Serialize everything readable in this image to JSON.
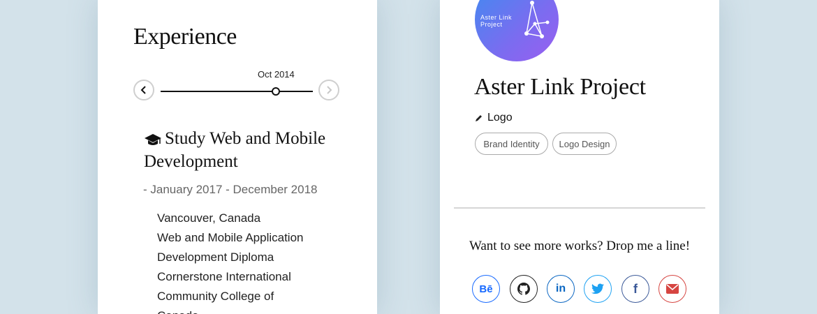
{
  "experience": {
    "title": "Experience",
    "timeline_date": "Oct 2014",
    "entry": {
      "title": "Study Web and Mobile Development",
      "period": "- January 2017 - December 2018",
      "details": [
        "Vancouver, Canada",
        "Web and Mobile Application",
        "Development Diploma",
        "Cornerstone International",
        "Community College of",
        "Canada"
      ]
    }
  },
  "project": {
    "logo_text_line1": "Aster Link",
    "logo_text_line2": "Project",
    "title": "Aster Link Project",
    "category": "Logo",
    "tags": [
      "Brand Identity",
      "Logo Design"
    ],
    "cta": "Want to see more works? Drop me a line!",
    "social": [
      {
        "name": "behance-icon",
        "label": "Bē",
        "color": "#1769ff"
      },
      {
        "name": "github-icon",
        "label": "",
        "color": "#222222"
      },
      {
        "name": "linkedin-icon",
        "label": "in",
        "color": "#0a66c2"
      },
      {
        "name": "twitter-icon",
        "label": "",
        "color": "#1da1f2"
      },
      {
        "name": "facebook-icon",
        "label": "f",
        "color": "#3b5998"
      },
      {
        "name": "email-icon",
        "label": "",
        "color": "#d64541"
      }
    ]
  }
}
